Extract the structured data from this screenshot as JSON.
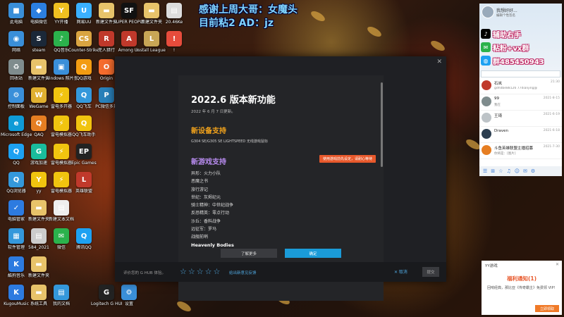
{
  "overlay": {
    "line1": "感谢上周大哥：女魔头",
    "line2": "目前粘2 AD：jz"
  },
  "desktop_icons": [
    {
      "label": "此电脑",
      "color": "#3a8fd9",
      "glyph": "■"
    },
    {
      "label": "电脑微信",
      "color": "#2c7fe0",
      "glyph": "◆"
    },
    {
      "label": "YY开播",
      "color": "#f0c020",
      "glyph": "Y"
    },
    {
      "label": "网易UU",
      "color": "#3ab0ff",
      "glyph": "U"
    },
    {
      "label": "新建文件夹",
      "color": "#e8c36a",
      "glyph": "▬"
    },
    {
      "label": "SUPER PEOPLE CBT",
      "color": "#111111",
      "glyph": "SF"
    },
    {
      "label": "新建文件夹",
      "color": "#e8c36a",
      "glyph": "▬"
    },
    {
      "label": "20.46Ke",
      "color": "#dddddd",
      "glyph": "▤"
    },
    {
      "label": "网络",
      "color": "#3a8fd9",
      "glyph": "◉"
    },
    {
      "label": "steam",
      "color": "#1b2838",
      "glyph": "S"
    },
    {
      "label": "QQ音乐",
      "color": "#2bb24c",
      "glyph": "♪"
    },
    {
      "label": "Counter-Strike Global Off...",
      "color": "#d9a441",
      "glyph": "CS"
    },
    {
      "label": "芜人猎行",
      "color": "#c0392b",
      "glyph": "R"
    },
    {
      "label": "Among Us",
      "color": "#c0392b",
      "glyph": "A"
    },
    {
      "label": "Install League o...",
      "color": "#c8a656",
      "glyph": "L"
    },
    {
      "label": "!",
      "color": "#e74c3c",
      "glyph": "!"
    },
    {
      "label": "回收站",
      "color": "#7f8c8d",
      "glyph": "♻"
    },
    {
      "label": "新建文件夹",
      "color": "#e8c36a",
      "glyph": "▬"
    },
    {
      "label": "windows 照片查看器",
      "color": "#3a8fd9",
      "glyph": "▣"
    },
    {
      "label": "QQ游戏",
      "color": "#f39c12",
      "glyph": "Q"
    },
    {
      "label": "Origin",
      "color": "#f56c2d",
      "glyph": "O"
    },
    {
      "label": "控制面板",
      "color": "#3a8fd9",
      "glyph": "⚙"
    },
    {
      "label": "WeGame",
      "color": "#e0b030",
      "glyph": "W"
    },
    {
      "label": "雷电多开器",
      "color": "#f1c40f",
      "glyph": "⚡"
    },
    {
      "label": "QQ飞车",
      "color": "#3498db",
      "glyph": "Q"
    },
    {
      "label": "PC微信多开",
      "color": "#2980b9",
      "glyph": "P"
    },
    {
      "label": "Microsoft Edge",
      "color": "#0f9bd7",
      "glyph": "e"
    },
    {
      "label": "QAQ",
      "color": "#e67e22",
      "glyph": "Q"
    },
    {
      "label": "雷电模拟器",
      "color": "#f1c40f",
      "glyph": "⚡"
    },
    {
      "label": "QQ飞车助手",
      "color": "#f1c40f",
      "glyph": "Q"
    },
    {
      "label": "QQ",
      "color": "#1da1f2",
      "glyph": "Q"
    },
    {
      "label": "游戏加速",
      "color": "#1abc9c",
      "glyph": "G"
    },
    {
      "label": "雷电模拟器",
      "color": "#f1c40f",
      "glyph": "⚡"
    },
    {
      "label": "Epic Games",
      "color": "#222222",
      "glyph": "EP"
    },
    {
      "label": "QQ浏览器",
      "color": "#3498db",
      "glyph": "Q"
    },
    {
      "label": "yy",
      "color": "#f1c40f",
      "glyph": "Y"
    },
    {
      "label": "雷电模拟器",
      "color": "#f1c40f",
      "glyph": "⚡"
    },
    {
      "label": "英雄联盟",
      "color": "#c0392b",
      "glyph": "L"
    },
    {
      "label": "电脑管家",
      "color": "#2d7be0",
      "glyph": "✓"
    },
    {
      "label": "新建文件夹",
      "color": "#e8c36a",
      "glyph": "▬"
    },
    {
      "label": "新建文本文档",
      "color": "#eeeeee",
      "glyph": "▤"
    },
    {
      "label": "软件管理",
      "color": "#3498db",
      "glyph": "▦"
    },
    {
      "label": "584_2021",
      "color": "#cccccc",
      "glyph": "▤"
    },
    {
      "label": "微信",
      "color": "#2bb24c",
      "glyph": "✉"
    },
    {
      "label": "腾讯QQ",
      "color": "#1da1f2",
      "glyph": "Q"
    },
    {
      "label": "酷狗音乐",
      "color": "#2d7be0",
      "glyph": "K"
    },
    {
      "label": "新建文件夹",
      "color": "#e8c36a",
      "glyph": "▬"
    },
    {
      "label": "KugouMusic",
      "color": "#2d7be0",
      "glyph": "K"
    },
    {
      "label": "系统工具",
      "color": "#e8c36a",
      "glyph": "▬"
    },
    {
      "label": "我的文档",
      "color": "#3498db",
      "glyph": "▤"
    },
    {
      "label": "Logitech G HUB",
      "color": "#222222",
      "glyph": "G"
    },
    {
      "label": "设置",
      "color": "#3a8fd9",
      "glyph": "⚙"
    }
  ],
  "modal": {
    "close_label": "✕",
    "title": "2022.6 版本新功能",
    "date": "2022 年 6 月 7 日更新。",
    "device_heading": "新设备支持",
    "device_line": "G304 SE/G305 SE LIGHTSPEED 无线游戏鼠标",
    "game_heading": "新游戏支持",
    "game_badge": "使用游戏前先设定，请耐心等待",
    "games": [
      "异形：火力小队",
      "恶魔之书",
      "旅行游记",
      "世纪：灰烬纪元",
      "骑士精神：中世纪战争",
      "反恐精英：零点行动",
      "沙丘：香料战争",
      "远征军：罗马",
      "战舰前哨",
      "Heavenly Bodies"
    ],
    "more_button": "了解更多",
    "ok_button": "确定",
    "rating": {
      "prompt": "评价您的 G HUB 体验。",
      "star_glyph": "☆",
      "stars": 5,
      "link": "给出新意见反馈",
      "right_action": "✕  取消",
      "submit": "提交"
    }
  },
  "chat": {
    "username": "我想好好...",
    "signature": "编辑个性签名",
    "promos": [
      {
        "text": "辅助右手",
        "icon": "♪",
        "icon_bg": "#000000",
        "icon_color": "#ffffff"
      },
      {
        "text": "粘粉+vx群",
        "icon": "✉",
        "icon_bg": "#2bb24c",
        "icon_color": "#ffffff"
      },
      {
        "text": "群485450943",
        "icon": "◍",
        "icon_bg": "#1da1f2",
        "icon_color": "#ffffff"
      }
    ],
    "contacts": [
      {
        "name": "石岚",
        "msg": "gdhdbe88126  77dianjing@",
        "time": "21:30",
        "avatar_color": "#c0392b"
      },
      {
        "name": "99",
        "msg": "我在",
        "time": "2021-8-15",
        "avatar_color": "#7f8c8d"
      },
      {
        "name": "王琦",
        "msg": "",
        "time": "2021-6-19",
        "avatar_color": "#bdc3c7"
      },
      {
        "name": "Draven",
        "msg": "",
        "time": "2021-6-18",
        "avatar_color": "#2c3e50"
      },
      {
        "name": "斗鱼英雄联盟主播招募",
        "msg": "你将是：[图片]",
        "time": "2021-7-30",
        "avatar_color": "#e67e22"
      }
    ],
    "footer_icons": [
      "☰",
      "⊞",
      "☆",
      "♫",
      "☺",
      "✉",
      "⚙"
    ]
  },
  "popup": {
    "title": "YY游戏",
    "close": "✕",
    "heading": "福利通知(1)",
    "body": "回响经典，那比亚《传奇霸主》免费领 VIP!",
    "button": "立即领取"
  }
}
